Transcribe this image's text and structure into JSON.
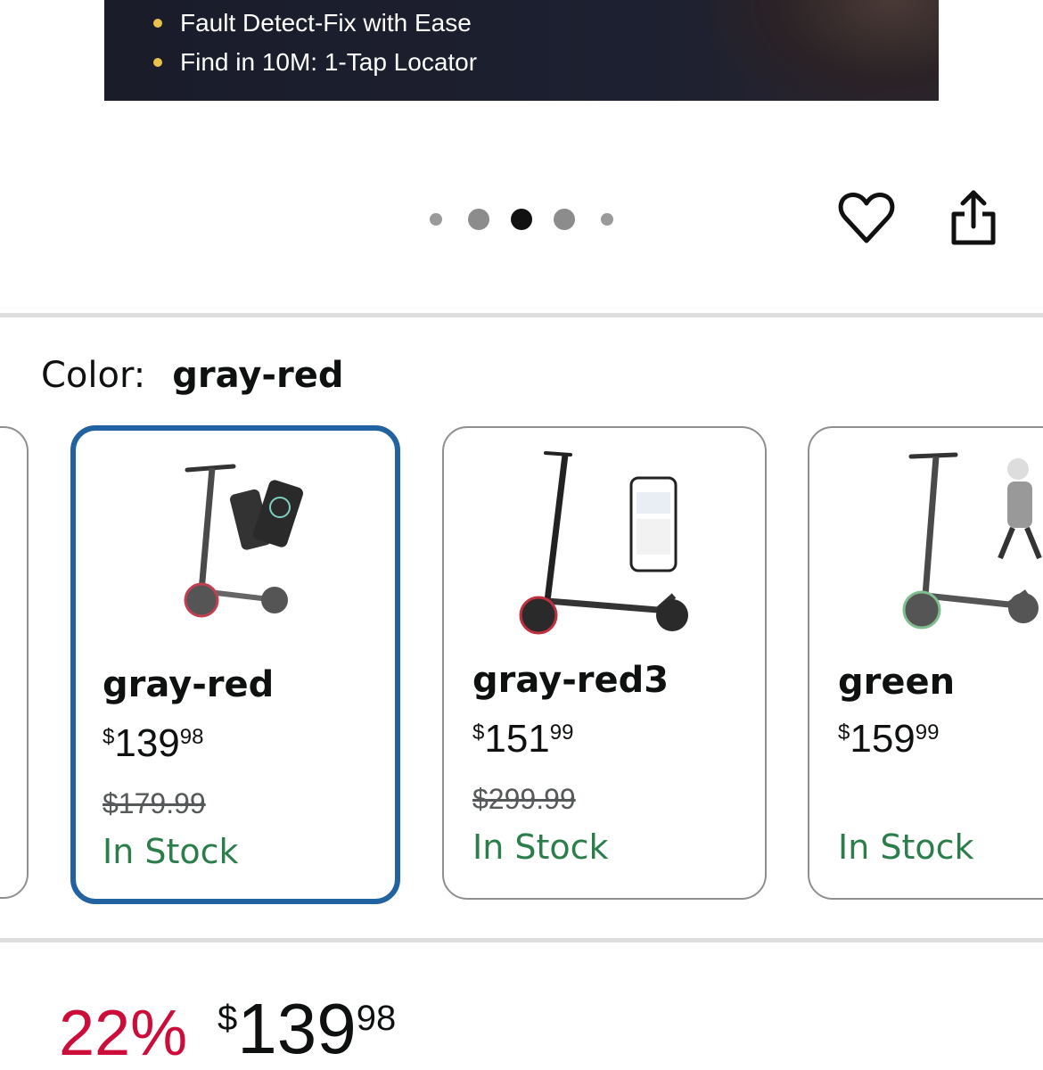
{
  "banner": {
    "bullets": [
      "Fault Detect-Fix with Ease",
      "Find in 10M: 1-Tap Locator"
    ]
  },
  "carousel": {
    "total": 5,
    "active_index": 2
  },
  "actions": {
    "wishlist_icon": "heart-icon",
    "share_icon": "share-icon"
  },
  "color": {
    "label": "Color:",
    "selected": "gray-red"
  },
  "variants": [
    {
      "name": "gray-red",
      "price_symbol": "$",
      "price_whole": "139",
      "price_fraction": "98",
      "list_price": "$179.99",
      "stock": "In Stock",
      "selected": true
    },
    {
      "name": "gray-red3",
      "price_symbol": "$",
      "price_whole": "151",
      "price_fraction": "99",
      "list_price": "$299.99",
      "stock": "In Stock",
      "selected": false
    },
    {
      "name": "green",
      "price_symbol": "$",
      "price_whole": "159",
      "price_fraction": "99",
      "list_price": "",
      "stock": "In Stock",
      "selected": false
    }
  ],
  "deal": {
    "percent": "22%",
    "price_symbol": "$",
    "price_whole": "139",
    "price_fraction": "98"
  },
  "colors": {
    "accent_blue": "#2162a1",
    "discount_red": "#cc0c39",
    "stock_green": "#2b7e4a",
    "bullet_yellow": "#e8c24a"
  }
}
